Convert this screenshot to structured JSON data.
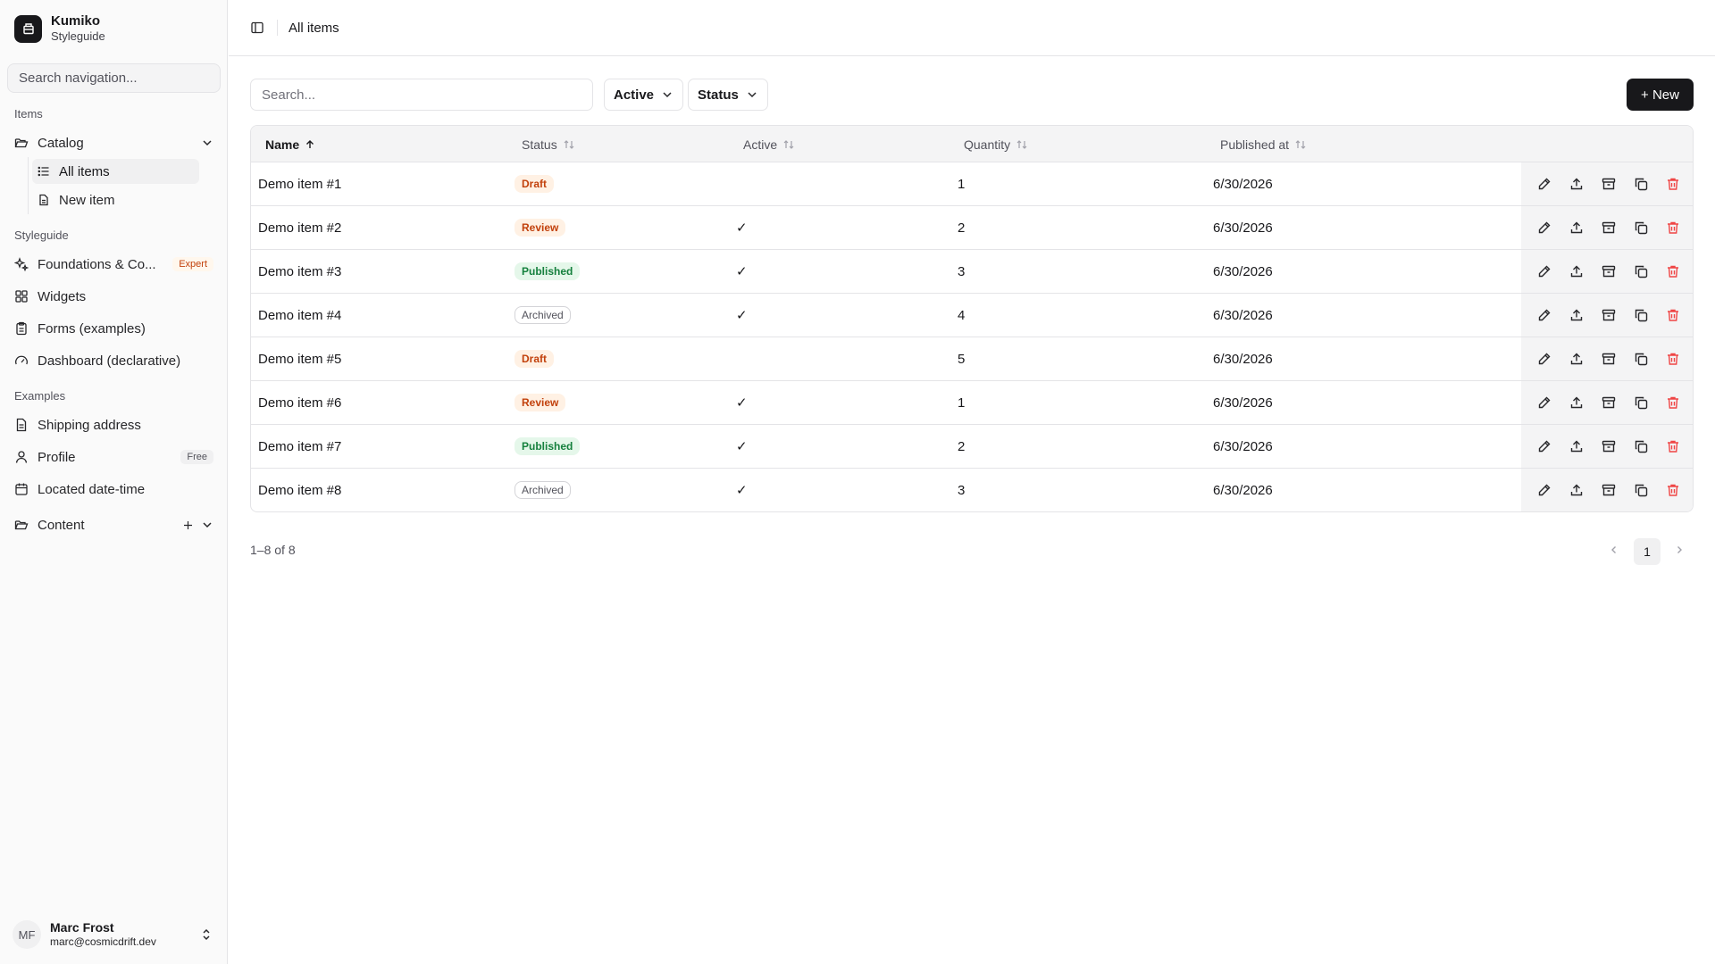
{
  "app": {
    "name": "Kumiko",
    "subtitle": "Styleguide"
  },
  "sidebar": {
    "search_placeholder": "Search navigation...",
    "groups": {
      "items": "Items",
      "styleguide": "Styleguide",
      "examples": "Examples"
    },
    "catalog": {
      "label": "Catalog",
      "children": [
        "All items",
        "New item"
      ],
      "active_child": "All items"
    },
    "styleguide_items": [
      {
        "label": "Foundations & Co...",
        "badge": "Expert",
        "icon": "sparkles-icon"
      },
      {
        "label": "Widgets",
        "icon": "grid-icon"
      },
      {
        "label": "Forms (examples)",
        "icon": "clipboard-icon"
      },
      {
        "label": "Dashboard (declarative)",
        "icon": "gauge-icon"
      }
    ],
    "example_items": [
      {
        "label": "Shipping address",
        "icon": "document-icon"
      },
      {
        "label": "Profile",
        "badge": "Free",
        "icon": "user-icon"
      },
      {
        "label": "Located date-time",
        "icon": "calendar-icon"
      }
    ],
    "content": {
      "label": "Content",
      "icon": "folder-icon"
    },
    "user": {
      "initials": "MF",
      "name": "Marc Frost",
      "email": "marc@cosmicdrift.dev"
    }
  },
  "header": {
    "breadcrumb": "All items"
  },
  "toolbar": {
    "search_placeholder": "Search...",
    "filter_active": "Active",
    "filter_status": "Status",
    "new_label": "+ New"
  },
  "table": {
    "columns": [
      "Name",
      "Status",
      "Active",
      "Quantity",
      "Published at"
    ],
    "sorted_column": "Name",
    "sort_direction": "ascending",
    "rows": [
      {
        "name": "Demo item #1",
        "status": "Draft",
        "active": "",
        "quantity": "1",
        "published_at": "6/30/2026"
      },
      {
        "name": "Demo item #2",
        "status": "Review",
        "active": "✓",
        "quantity": "2",
        "published_at": "6/30/2026"
      },
      {
        "name": "Demo item #3",
        "status": "Published",
        "active": "✓",
        "quantity": "3",
        "published_at": "6/30/2026"
      },
      {
        "name": "Demo item #4",
        "status": "Archived",
        "active": "✓",
        "quantity": "4",
        "published_at": "6/30/2026"
      },
      {
        "name": "Demo item #5",
        "status": "Draft",
        "active": "",
        "quantity": "5",
        "published_at": "6/30/2026"
      },
      {
        "name": "Demo item #6",
        "status": "Review",
        "active": "✓",
        "quantity": "1",
        "published_at": "6/30/2026"
      },
      {
        "name": "Demo item #7",
        "status": "Published",
        "active": "✓",
        "quantity": "2",
        "published_at": "6/30/2026"
      },
      {
        "name": "Demo item #8",
        "status": "Archived",
        "active": "✓",
        "quantity": "3",
        "published_at": "6/30/2026"
      }
    ],
    "row_actions": [
      "edit-icon",
      "publish-icon",
      "archive-icon",
      "duplicate-icon",
      "delete-icon"
    ]
  },
  "pagination": {
    "summary": "1–8 of 8",
    "current_page": "1"
  },
  "colors": {
    "accent": "#18181b",
    "danger": "#ef4444",
    "warning_text": "#c2410c",
    "success_text": "#15803d"
  }
}
